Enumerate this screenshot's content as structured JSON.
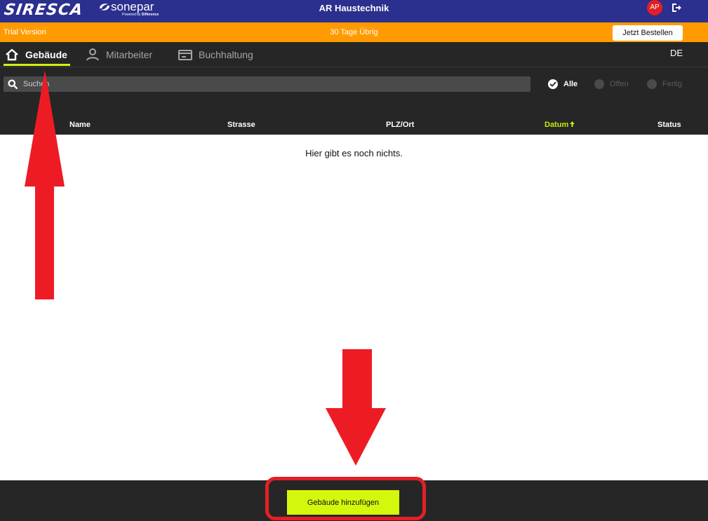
{
  "header": {
    "brand_logo": "SIRESCA",
    "partner_logo": "sonepar",
    "partner_tagline": "Powered by Difference",
    "app_title": "AR Haustechnik",
    "avatar_initials": "AP",
    "logout_icon": "logout-icon",
    "colors": {
      "header_bg": "#2b2f8e",
      "avatar_bg": "#e21f26"
    }
  },
  "trial": {
    "label": "Trial Version",
    "days_left": "30 Tage Übrig",
    "order_button": "Jetzt Bestellen",
    "color": "#ff9b00"
  },
  "nav": {
    "tabs": [
      {
        "label": "Gebäude",
        "icon": "home-icon",
        "active": true
      },
      {
        "label": "Mitarbeiter",
        "icon": "person-icon",
        "active": false
      },
      {
        "label": "Buchhaltung",
        "icon": "wallet-icon",
        "active": false
      }
    ],
    "language": "DE",
    "accent": "#d4f10e"
  },
  "search": {
    "placeholder": "Suchen",
    "value": ""
  },
  "filters": [
    {
      "label": "Alle",
      "selected": true
    },
    {
      "label": "Offen",
      "selected": false
    },
    {
      "label": "Fertig",
      "selected": false
    }
  ],
  "table": {
    "columns": [
      "Name",
      "Strasse",
      "PLZ/Ort",
      "Datum",
      "Status"
    ],
    "sorted_column": "Datum",
    "sort_icon": "arrow-up-icon",
    "empty_message": "Hier gibt es noch nichts."
  },
  "footer": {
    "add_button": "Gebäude hinzufügen",
    "button_color": "#d4f80c"
  },
  "annotations": {
    "color": "#e32026",
    "items": [
      "up-arrow",
      "down-arrow",
      "highlight-frame"
    ]
  }
}
